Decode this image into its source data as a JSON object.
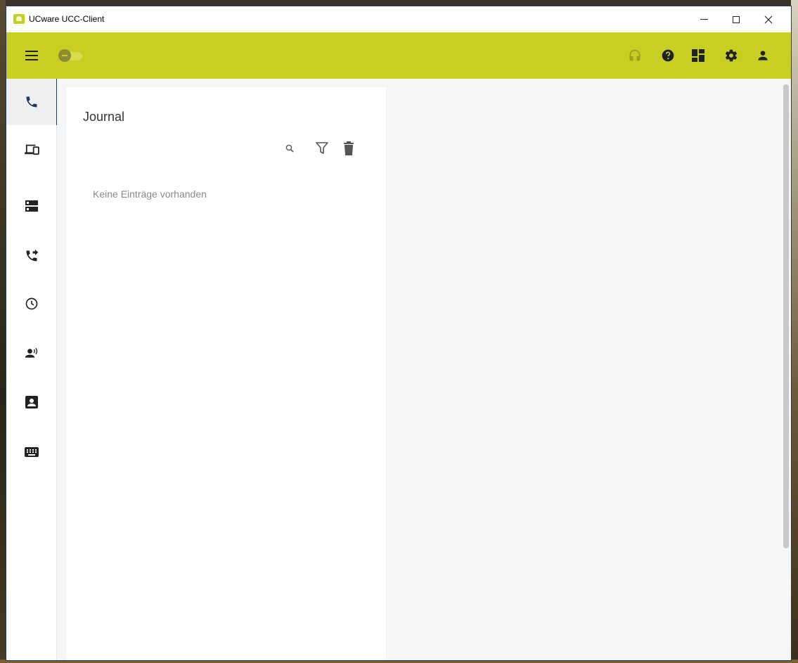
{
  "window": {
    "title": "UCware UCC-Client"
  },
  "colors": {
    "accent": "#c8cf23",
    "active_indicator": "#1e3a5f",
    "icon": "#222222"
  },
  "toolbar": {
    "menu_icon": "menu-icon",
    "status_toggle_on": false,
    "right_icons": [
      "headset-icon",
      "help-icon",
      "dashboard-icon",
      "settings-icon",
      "account-icon"
    ]
  },
  "sidebar": {
    "items": [
      {
        "id": "journal",
        "icon": "phone-icon",
        "active": true
      },
      {
        "id": "devices",
        "icon": "devices-icon",
        "active": false
      },
      {
        "id": "storage",
        "icon": "storage-icon",
        "active": false
      },
      {
        "id": "call-forward",
        "icon": "phone-forward-icon",
        "active": false
      },
      {
        "id": "history",
        "icon": "clock-icon",
        "active": false
      },
      {
        "id": "presence",
        "icon": "record-voice-icon",
        "active": false
      },
      {
        "id": "contacts",
        "icon": "contact-card-icon",
        "active": false
      },
      {
        "id": "keypad",
        "icon": "keyboard-icon",
        "active": false
      }
    ]
  },
  "journal": {
    "title": "Journal",
    "empty_message": "Keine Einträge vorhanden"
  }
}
